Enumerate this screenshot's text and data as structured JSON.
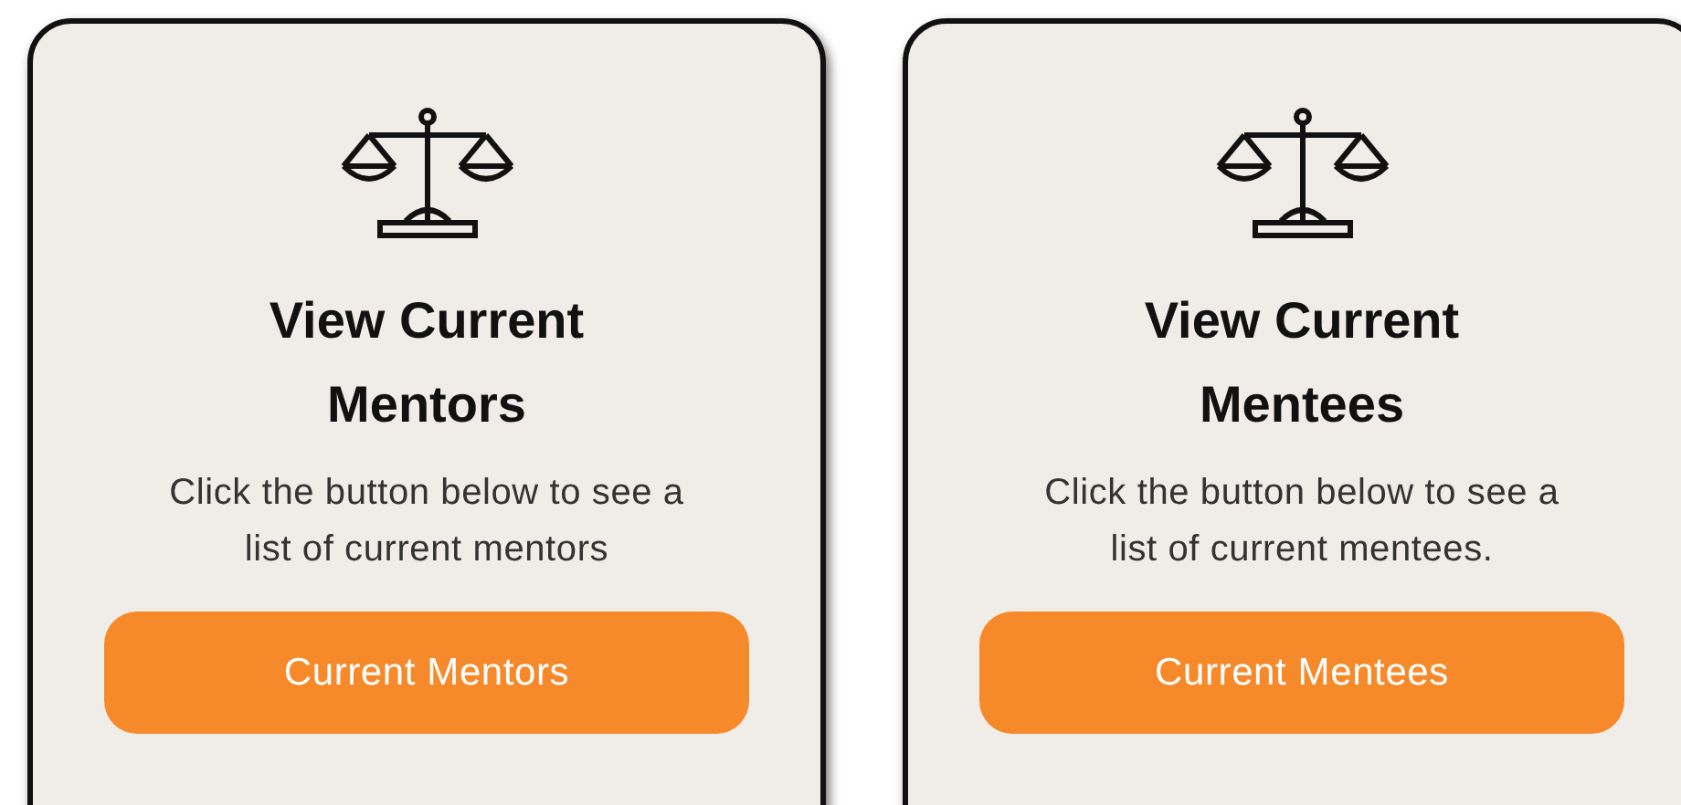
{
  "cards": [
    {
      "title": "View Current Mentors",
      "description": "Click the button below to see a list of current mentors",
      "button": "Current Mentors"
    },
    {
      "title": "View Current Mentees",
      "description": "Click the button below to see a list of current mentees.",
      "button": "Current Mentees"
    }
  ]
}
